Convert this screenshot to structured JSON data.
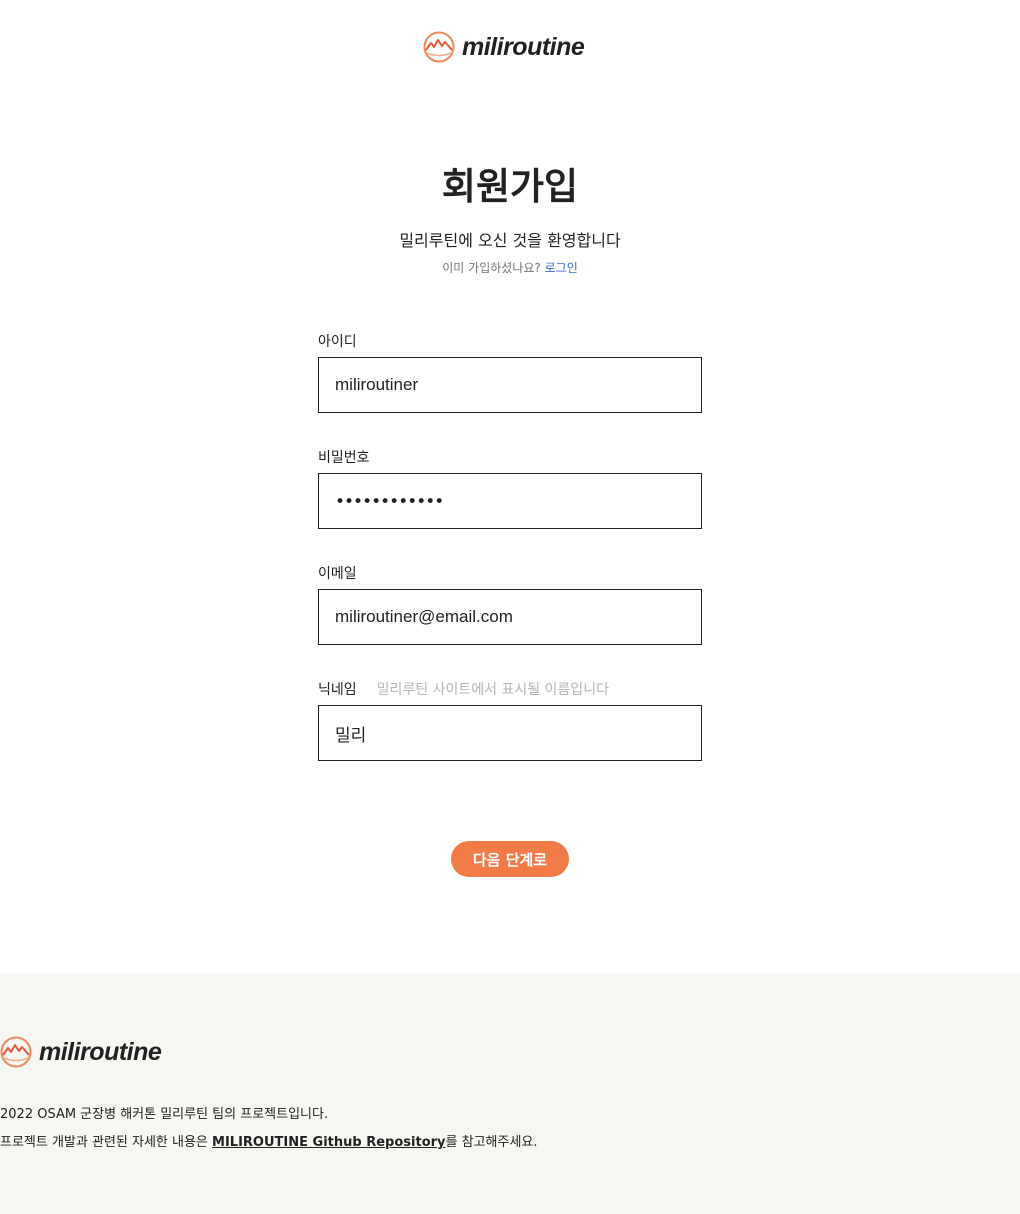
{
  "header": {
    "logo_text": "miliroutine",
    "logo_icon": "mountain-sun-logo-icon"
  },
  "page": {
    "title": "회원가입",
    "welcome": "밀리루틴에 오신 것을 환영합니다",
    "login_prompt": "이미 가입하셨나요?",
    "login_link": "로그인"
  },
  "form": {
    "username": {
      "label": "아이디",
      "value": "miliroutiner"
    },
    "password": {
      "label": "비밀번호",
      "masked": "••••••••••••"
    },
    "email": {
      "label": "이메일",
      "value": "miliroutiner@email.com"
    },
    "nickname": {
      "label": "닉네임",
      "hint": "밀리루틴 사이트에서 표시될 이름입니다",
      "value": "밀리"
    },
    "next_button": "다음 단계로"
  },
  "footer": {
    "logo_text": "miliroutine",
    "line1": "2022 OSAM 군장병 해커톤 밀리루틴 팀의 프로젝트입니다.",
    "line2_prefix": "프로젝트 개발과 관련된 자세한 내용은 ",
    "line2_link": "MILIROUTINE Github Repository",
    "line2_suffix": "를 참고해주세요."
  },
  "colors": {
    "accent": "#f07b47",
    "link": "#3a6fc8",
    "footer_bg": "#f8f6f2"
  }
}
